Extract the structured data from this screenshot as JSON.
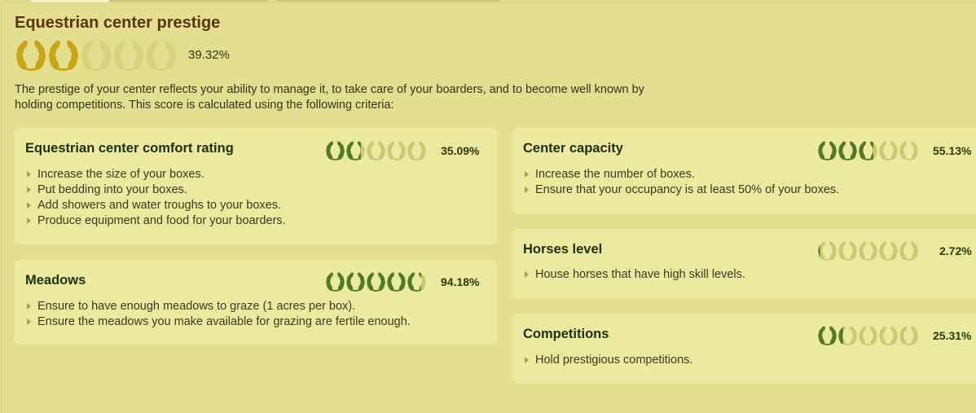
{
  "header": {
    "title": "Equestrian center prestige",
    "rating_value": 39.32,
    "rating_pct": "39.32%",
    "intro": "The prestige of your center reflects your ability to manage it, to take care of your boarders, and to become well known by holding competitions. This score is calculated using the following criteria:"
  },
  "cards": {
    "comfort": {
      "title": "Equestrian center comfort rating",
      "value": 35.09,
      "pct": "35.09%",
      "items": [
        "Increase the size of your boxes.",
        "Put bedding into your boxes.",
        "Add showers and water troughs to your boxes.",
        "Produce equipment and food for your boarders."
      ]
    },
    "meadows": {
      "title": "Meadows",
      "value": 94.18,
      "pct": "94.18%",
      "items": [
        "Ensure to have enough meadows to graze (1 acres per box).",
        "Ensure the meadows you make available for grazing are fertile enough."
      ]
    },
    "capacity": {
      "title": "Center capacity",
      "value": 55.13,
      "pct": "55.13%",
      "items": [
        "Increase the number of boxes.",
        "Ensure that your occupancy is at least 50% of your boxes."
      ]
    },
    "horses": {
      "title": "Horses level",
      "value": 2.72,
      "pct": "2.72%",
      "items": [
        "House horses that have high skill levels."
      ]
    },
    "competitions": {
      "title": "Competitions",
      "value": 25.31,
      "pct": "25.31%",
      "items": [
        "Hold prestigious competitions."
      ]
    }
  },
  "colors": {
    "gold_filled": "#c9a414",
    "gold_empty": "#d8d27a",
    "green_filled": "#4f7a2a",
    "green_empty": "#c9cb72",
    "title_brown": "#5a3412"
  },
  "icons": {
    "laurel": "laurel-wreath-icon",
    "bullet": "triangle-bullet-icon"
  }
}
